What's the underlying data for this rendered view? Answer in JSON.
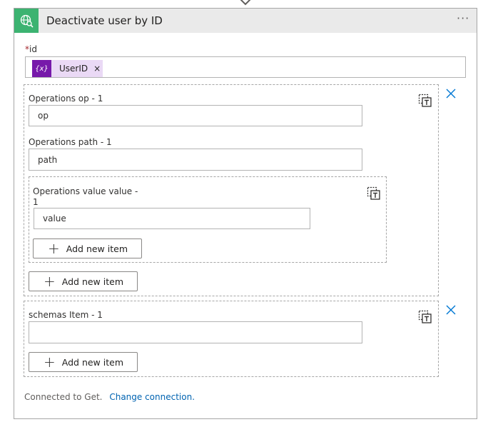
{
  "action": {
    "title": "Deactivate user by ID",
    "more_label": "···",
    "id_field": {
      "required_mark": "*",
      "label": "id",
      "token_icon_text": "{x}",
      "token_label": "UserID",
      "token_remove": "×"
    }
  },
  "operations_group": {
    "op": {
      "label": "Operations op - 1",
      "value": "op"
    },
    "path": {
      "label": "Operations path - 1",
      "value": "path"
    },
    "value_group": {
      "label_line1": "Operations value value -",
      "label_line2": "1",
      "value": "value",
      "add_label": "Add new item"
    },
    "add_label": "Add new item"
  },
  "schemas_group": {
    "label": "schemas Item - 1",
    "value": "",
    "add_label": "Add new item"
  },
  "footer": {
    "connected_text": "Connected to Get.",
    "change_link": "Change connection."
  },
  "colors": {
    "header_icon_bg": "#3cb371",
    "token_icon_bg": "#7719aa",
    "token_bg": "#ead9f5",
    "close_x": "#0078d4",
    "link": "#0063b1"
  }
}
